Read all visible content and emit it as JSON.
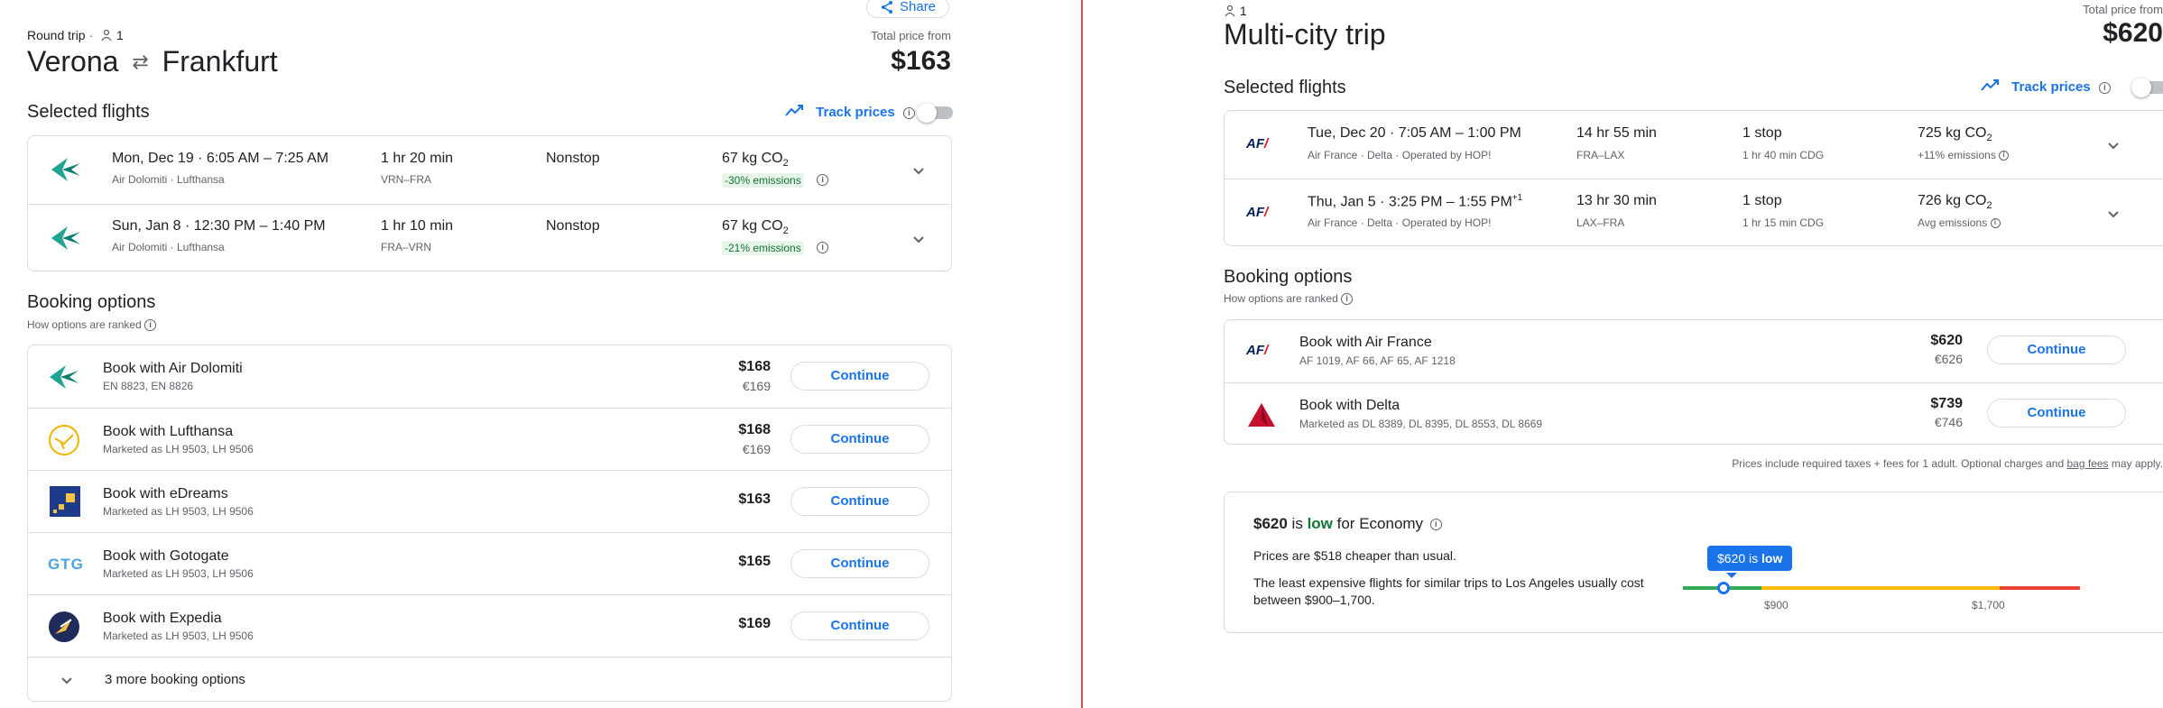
{
  "left": {
    "share_label": "Share",
    "trip_type": "Round trip",
    "passengers": "1",
    "origin": "Verona",
    "destination": "Frankfurt",
    "total_label": "Total price from",
    "total_price": "$163",
    "selected_flights_heading": "Selected flights",
    "track_prices_label": "Track prices",
    "flights": [
      {
        "date_time": "Mon, Dec 19  ·  6:05 AM – 7:25 AM",
        "airlines": "Air Dolomiti · Lufthansa",
        "duration": "1 hr 20 min",
        "route": "VRN–FRA",
        "stops": "Nonstop",
        "co2": "67 kg CO",
        "co2_sub": "2",
        "emissions": "-30% emissions"
      },
      {
        "date_time": "Sun, Jan 8  ·  12:30 PM – 1:40 PM",
        "airlines": "Air Dolomiti · Lufthansa",
        "duration": "1 hr 10 min",
        "route": "FRA–VRN",
        "stops": "Nonstop",
        "co2": "67 kg CO",
        "co2_sub": "2",
        "emissions": "-21% emissions"
      }
    ],
    "booking_heading": "Booking options",
    "ranking_note": "How options are ranked",
    "options": [
      {
        "title": "Book with Air Dolomiti",
        "sub": "EN 8823, EN 8826",
        "price": "$168",
        "price_eur": "€169",
        "button": "Continue"
      },
      {
        "title": "Book with Lufthansa",
        "sub": "Marketed as LH 9503, LH 9506",
        "price": "$168",
        "price_eur": "€169",
        "button": "Continue"
      },
      {
        "title": "Book with eDreams",
        "sub": "Marketed as LH 9503, LH 9506",
        "price": "$163",
        "price_eur": "",
        "button": "Continue"
      },
      {
        "title": "Book with Gotogate",
        "sub": "Marketed as LH 9503, LH 9506",
        "price": "$165",
        "price_eur": "",
        "button": "Continue"
      },
      {
        "title": "Book with Expedia",
        "sub": "Marketed as LH 9503, LH 9506",
        "price": "$169",
        "price_eur": "",
        "button": "Continue"
      }
    ],
    "more_options": "3 more booking options",
    "gotogate_logo_text": "GTG"
  },
  "right": {
    "passengers": "1",
    "title": "Multi-city trip",
    "total_label": "Total price from",
    "total_price": "$620",
    "selected_flights_heading": "Selected flights",
    "track_prices_label": "Track prices",
    "af_logo_text": "AF",
    "flights": [
      {
        "date": "Tue, Dec 20",
        "times": "7:05 AM – 1:00 PM",
        "times_sup": "",
        "airlines": "Air France · Delta · Operated by HOP!",
        "duration": "14 hr 55 min",
        "route": "FRA–LAX",
        "stops": "1 stop",
        "layover": "1 hr 40 min CDG",
        "co2": "725 kg CO",
        "co2_sub": "2",
        "emissions": "+11% emissions"
      },
      {
        "date": "Thu, Jan 5",
        "times": "3:25 PM – 1:55 PM",
        "times_sup": "+1",
        "airlines": "Air France · Delta · Operated by HOP!",
        "duration": "13 hr 30 min",
        "route": "LAX–FRA",
        "stops": "1 stop",
        "layover": "1 hr 15 min CDG",
        "co2": "726 kg CO",
        "co2_sub": "2",
        "emissions": "Avg emissions"
      }
    ],
    "booking_heading": "Booking options",
    "ranking_note": "How options are ranked",
    "options": [
      {
        "title": "Book with Air France",
        "sub": "AF 1019, AF 66, AF 65, AF 1218",
        "price": "$620",
        "price_eur": "€626",
        "button": "Continue"
      },
      {
        "title": "Book with Delta",
        "sub": "Marketed as DL 8389, DL 8395, DL 8553, DL 8669",
        "price": "$739",
        "price_eur": "€746",
        "button": "Continue"
      }
    ],
    "fees_note_prefix": "Prices include required taxes + fees for 1 adult. Optional charges and ",
    "fees_note_link": "bag fees",
    "fees_note_suffix": " may apply.",
    "insight": {
      "price": "$620",
      "is_word": " is ",
      "level": "low",
      "for_text": " for Economy",
      "cheaper_text": "Prices are $518 cheaper than usual.",
      "usual_text": "The least expensive flights for similar trips to Los Angeles usually cost between $900–1,700.",
      "tooltip_price": "$620",
      "tooltip_is": " is ",
      "tooltip_level": "low",
      "tick_low": "$900",
      "tick_high": "$1,700"
    }
  }
}
